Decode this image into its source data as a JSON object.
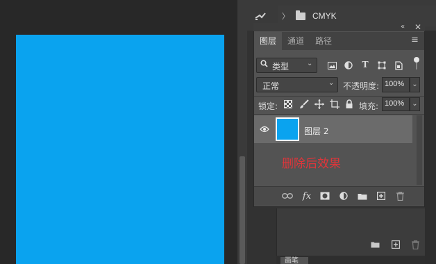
{
  "canvas": {
    "document_color": "#0aa3ef"
  },
  "channels": {
    "group_label": "CMYK"
  },
  "layers_panel": {
    "tabs": [
      {
        "label": "图层",
        "active": true
      },
      {
        "label": "通道",
        "active": false
      },
      {
        "label": "路径",
        "active": false
      }
    ],
    "filter": {
      "label": "类型"
    },
    "blend_mode": "正常",
    "opacity_label": "不透明度:",
    "opacity_value": "100%",
    "lock_label": "锁定:",
    "fill_label": "填充:",
    "fill_value": "100%",
    "layers": [
      {
        "name": "图层 2",
        "visible": true,
        "thumb_color": "#0aa3ef"
      }
    ]
  },
  "annotation": "删除后效果",
  "bottom_tab": {
    "label": "画笔"
  },
  "icons": {
    "collapse": "collapse-icon",
    "close": "close-icon",
    "menu": "panel-menu-icon"
  }
}
